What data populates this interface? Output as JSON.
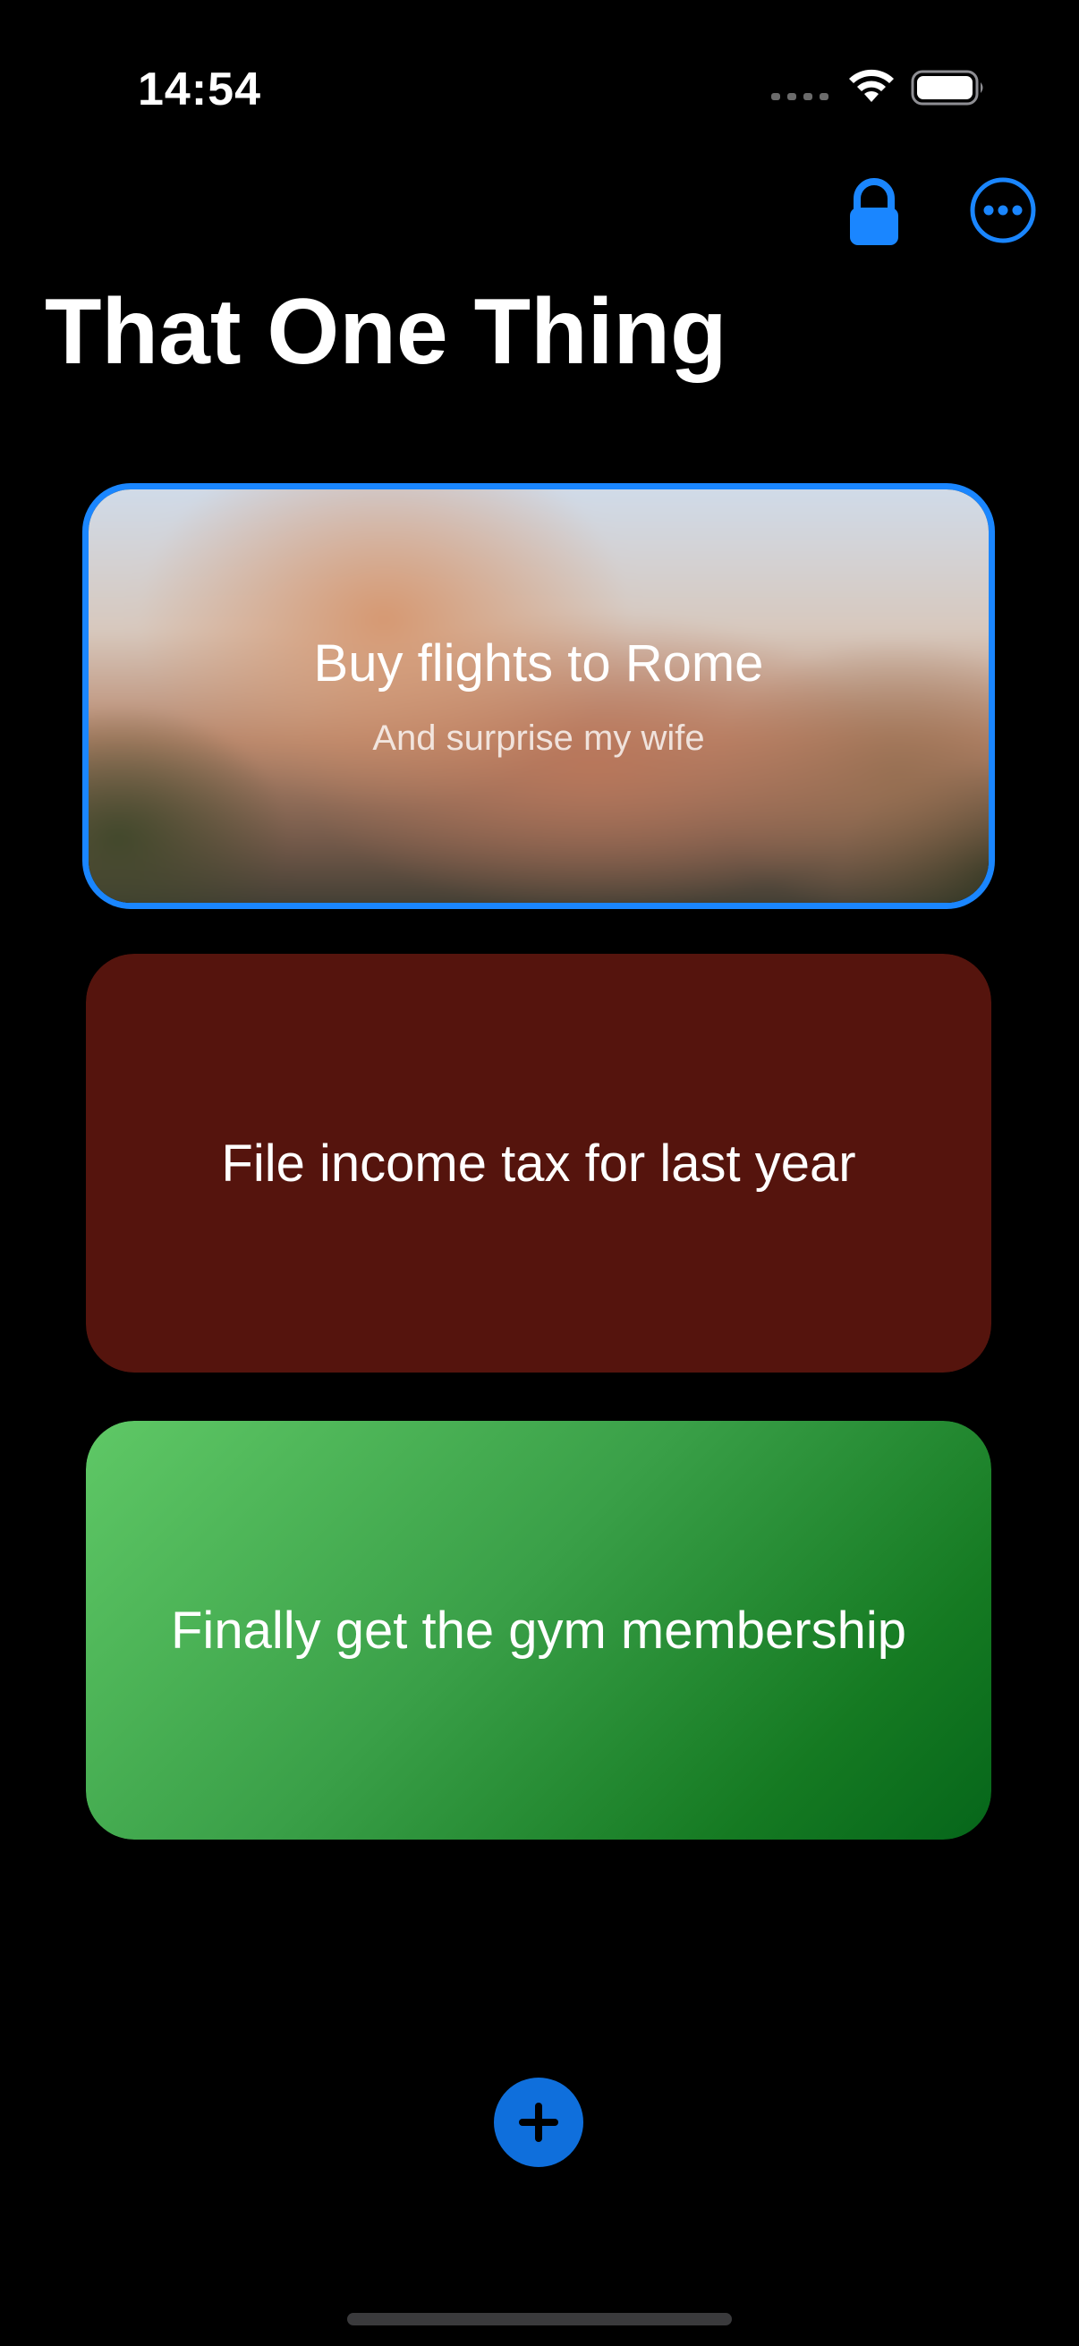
{
  "status_bar": {
    "time": "14:54",
    "icons": [
      "signal-dots-icon",
      "wifi-icon",
      "battery-icon"
    ]
  },
  "toolbar": {
    "lock_icon": "lock-icon",
    "more_icon": "ellipsis-circle-icon",
    "accent_color": "#1a86ff"
  },
  "header": {
    "title": "That One Thing"
  },
  "cards": [
    {
      "title": "Buy flights to Rome",
      "subtitle": "And surprise my wife",
      "background": "photo-colosseum-blurred",
      "selected": true
    },
    {
      "title": "File income tax for last year",
      "background_color": "#55140d",
      "selected": false
    },
    {
      "title": "Finally get the gym membership",
      "background_colors": [
        "#5fc866",
        "#06661a"
      ],
      "selected": false
    }
  ],
  "footer": {
    "add_icon": "plus-icon",
    "add_button_color": "#0f6fdc"
  }
}
